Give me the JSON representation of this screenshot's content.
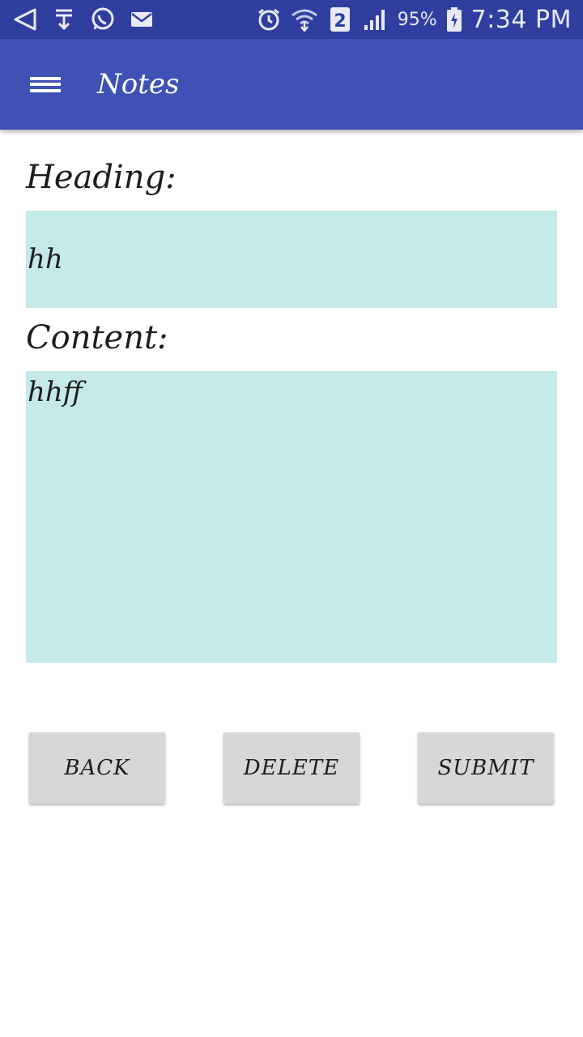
{
  "status_bar": {
    "battery_percent": "95%",
    "sim_badge": "2",
    "time": "7:34 PM",
    "icons": [
      "navigation-icon",
      "download-icon",
      "whatsapp-icon",
      "mail-icon",
      "alarm-icon",
      "wifi-icon",
      "sim-icon",
      "signal-icon",
      "battery-charging-icon"
    ]
  },
  "app_bar": {
    "title": "Notes",
    "menu_icon": "hamburger-menu-icon",
    "color": "#3f51b5"
  },
  "form": {
    "heading_label": "Heading:",
    "heading_value": "hh",
    "content_label": "Content:",
    "content_value": "hhff",
    "field_color": "#c4e9e8"
  },
  "buttons": {
    "back": "BACK",
    "delete": "DELETE",
    "submit": "SUBMIT"
  }
}
